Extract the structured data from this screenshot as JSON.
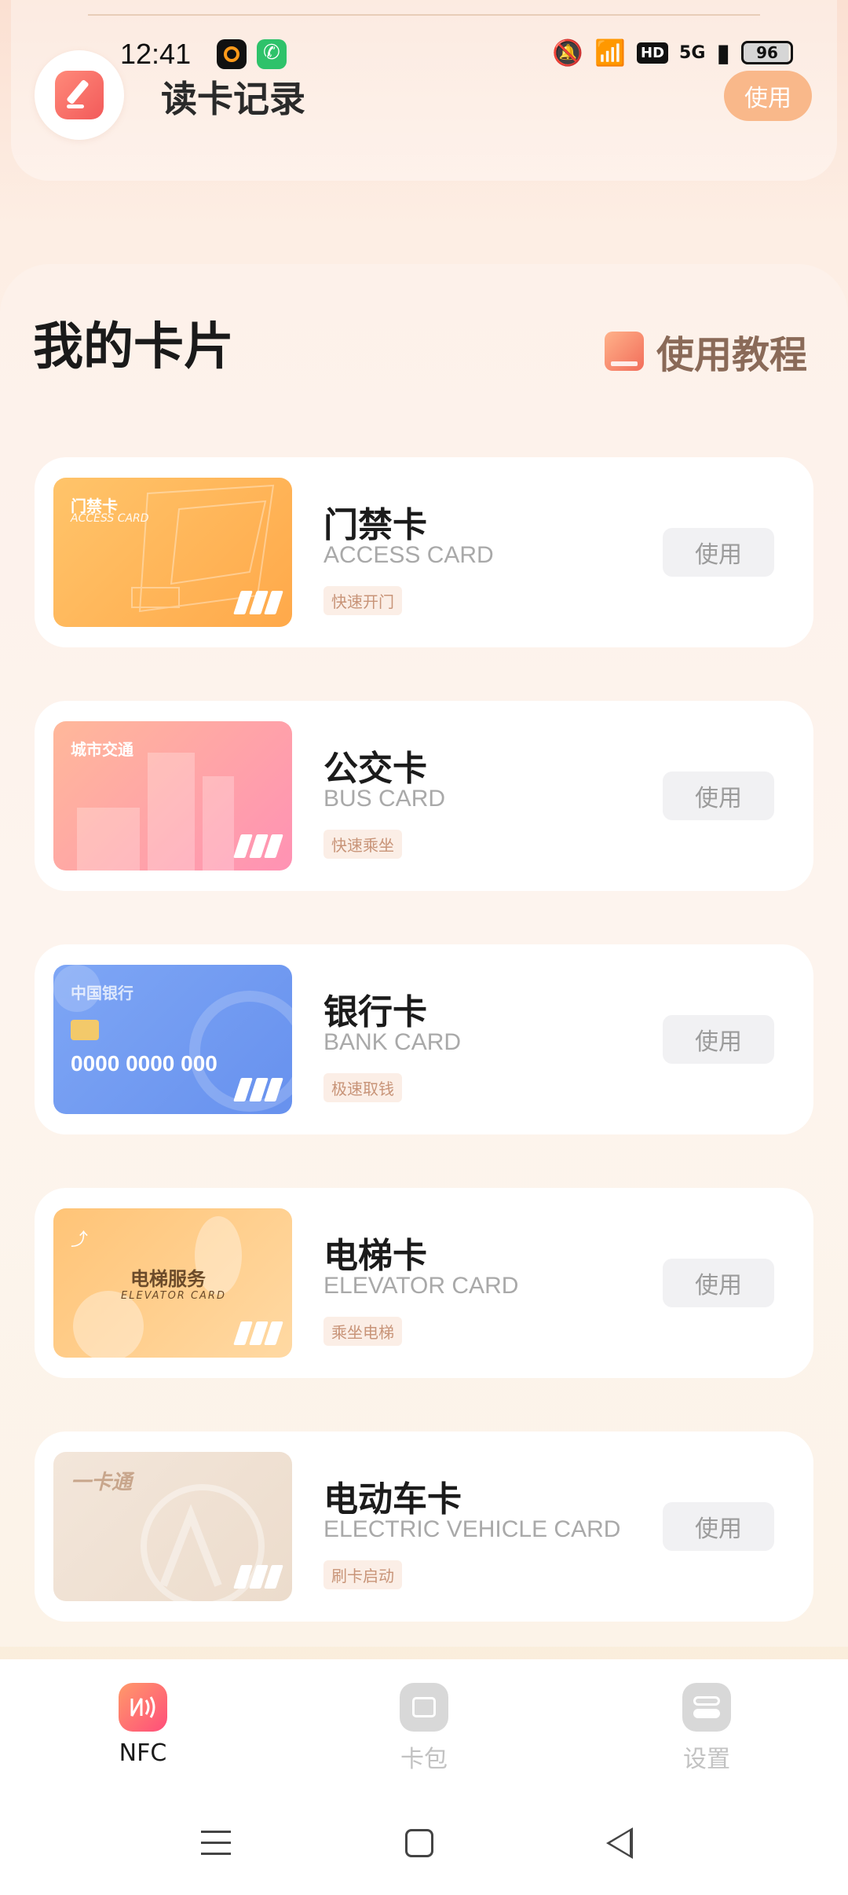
{
  "status_bar": {
    "time": "12:41",
    "network": "5G",
    "hd": "HD",
    "battery": "96"
  },
  "top_record": {
    "title": "读卡记录",
    "use_label": "使用"
  },
  "section": {
    "title": "我的卡片",
    "tutorial_label": "使用教程"
  },
  "cards": [
    {
      "name": "门禁卡",
      "en": "ACCESS CARD",
      "tag": "快速开门",
      "use_label": "使用",
      "thumb_label": "门禁卡",
      "thumb_sub": "ACCESS CARD"
    },
    {
      "name": "公交卡",
      "en": "BUS CARD",
      "tag": "快速乘坐",
      "use_label": "使用",
      "thumb_label": "城市交通"
    },
    {
      "name": "银行卡",
      "en": "BANK CARD",
      "tag": "极速取钱",
      "use_label": "使用",
      "thumb_label": "中国银行",
      "thumb_number": "0000  0000  000"
    },
    {
      "name": "电梯卡",
      "en": "ELEVATOR CARD",
      "tag": "乘坐电梯",
      "use_label": "使用",
      "thumb_label": "电梯服务",
      "thumb_sub": "ELEVATOR CARD"
    },
    {
      "name": "电动车卡",
      "en": "ELECTRIC VEHICLE CARD",
      "tag": "刷卡启动",
      "use_label": "使用",
      "thumb_label": "一卡通"
    }
  ],
  "bottom_nav": {
    "items": [
      {
        "label": "NFC",
        "icon": "nfc-icon",
        "active": true
      },
      {
        "label": "卡包",
        "icon": "wallet-icon",
        "active": false
      },
      {
        "label": "设置",
        "icon": "settings-icon",
        "active": false
      }
    ]
  },
  "colors": {
    "accent": "#f9b88a",
    "access": "#ffb457",
    "bus": "#ff99ad",
    "bank": "#6f98f0",
    "elevator": "#ffc477",
    "ev": "#efe2d6"
  }
}
